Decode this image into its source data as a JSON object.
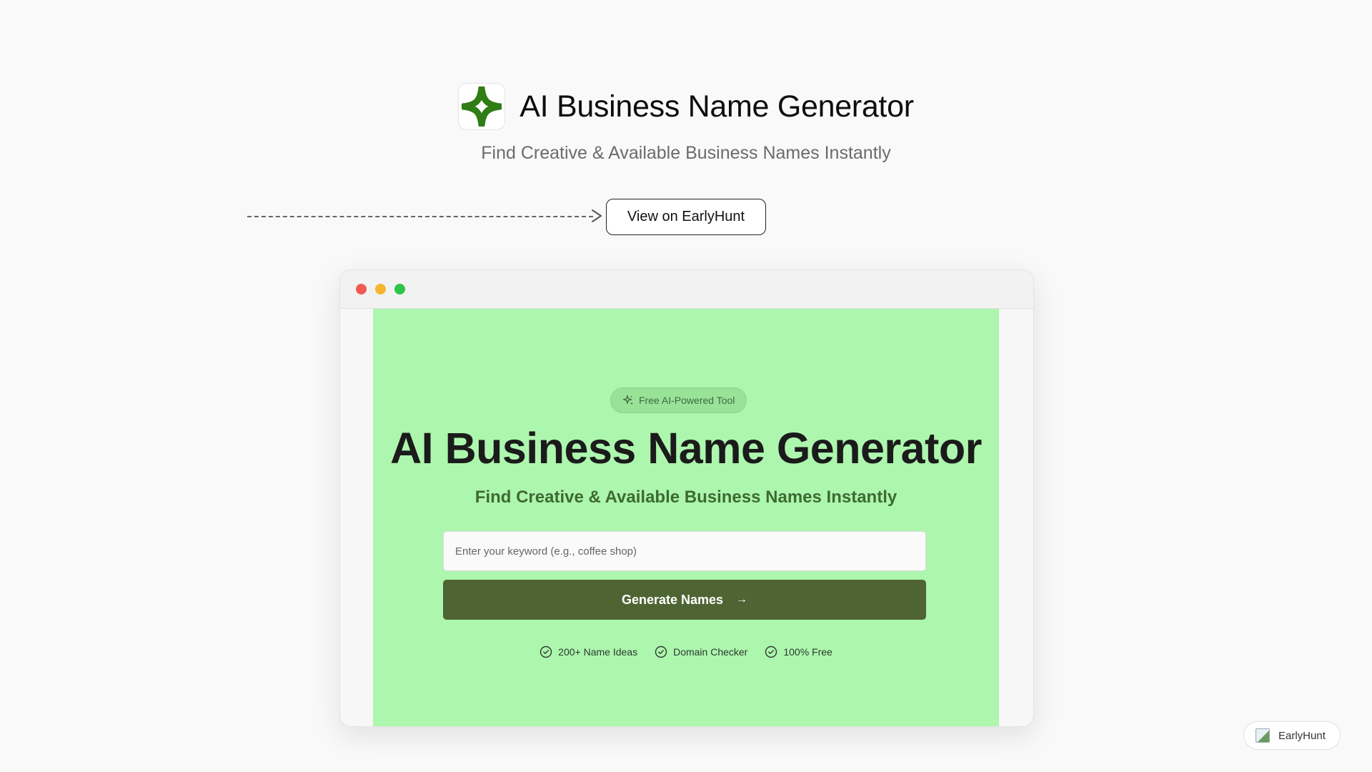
{
  "header": {
    "logo_icon": "four-point-star-icon",
    "title": "AI Business Name Generator",
    "subtitle": "Find Creative & Available Business Names Instantly"
  },
  "cta": {
    "view_label": "View on EarlyHunt"
  },
  "browser": {
    "dots": [
      "red",
      "yellow",
      "green"
    ],
    "badge_label": "Free AI-Powered Tool",
    "hero_title": "AI Business Name Generator",
    "hero_subtitle": "Find Creative & Available Business Names Instantly",
    "input_placeholder": "Enter your keyword (e.g., coffee shop)",
    "input_value": "",
    "generate_label": "Generate Names",
    "features": [
      {
        "label": "200+ Name Ideas",
        "icon": "check-circle-icon"
      },
      {
        "label": "Domain Checker",
        "icon": "check-circle-icon"
      },
      {
        "label": "100% Free",
        "icon": "check-circle-icon"
      }
    ]
  },
  "corner_badge": {
    "label": "EarlyHunt"
  },
  "colors": {
    "page_background": "#f9f9f9",
    "viewport_background": "#adf6ae",
    "generate_button": "#4e6533",
    "logo_green": "#2f7d14",
    "hero_subtitle": "#3d6a33"
  }
}
